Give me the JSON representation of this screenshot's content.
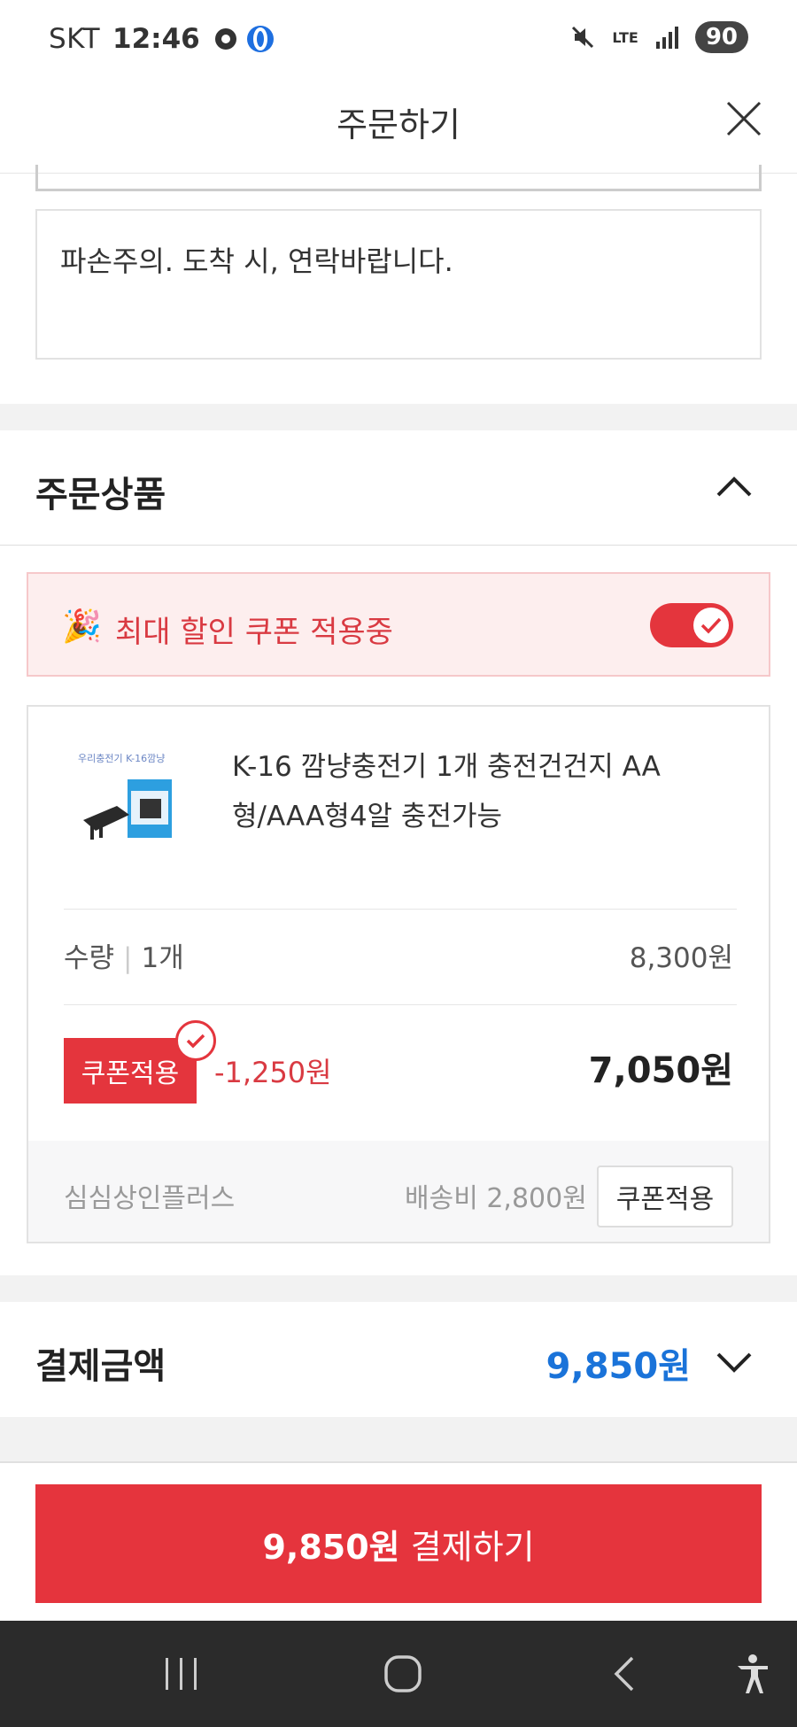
{
  "status_bar": {
    "carrier": "SKT",
    "time": "12:46",
    "network": "LTE",
    "battery": "90"
  },
  "header": {
    "title": "주문하기"
  },
  "memo": {
    "text": "파손주의. 도착 시, 연락바랍니다."
  },
  "order_items": {
    "title": "주문상품",
    "coupon_banner": {
      "emoji": "🎉",
      "text": "최대 할인 쿠폰 적용중",
      "toggle_on": true
    },
    "product": {
      "name": "K-16 깜냥충전기 1개 충전건건지 AA형/AAA형4알 충전가능",
      "image_text": "우리충전기 K-16깜냥",
      "qty_label": "수량",
      "qty_value": "1개",
      "unit_price": "8,300원",
      "coupon_tag": "쿠폰적용",
      "discount": "-1,250원",
      "final_price": "7,050원",
      "seller": "심심상인플러스",
      "shipping": "배송비 2,800원",
      "coupon_button": "쿠폰적용"
    }
  },
  "payment": {
    "label": "결제금액",
    "amount": "9,850원"
  },
  "pay_button": {
    "amount": "9,850원",
    "label": " 결제하기"
  },
  "colors": {
    "accent_red": "#e5343d",
    "blue": "#1a73d9"
  }
}
